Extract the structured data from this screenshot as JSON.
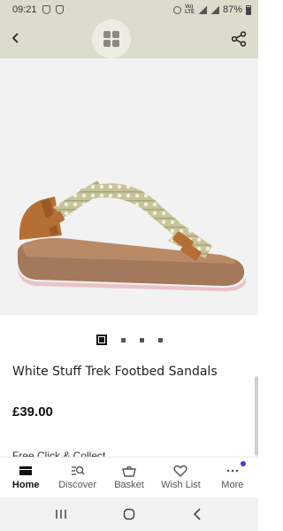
{
  "status_bar": {
    "time": "09:21",
    "battery": "87%"
  },
  "product": {
    "title": "White Stuff Trek Footbed Sandals",
    "price": "£39.00",
    "collect_text": "Free Click & Collect"
  },
  "pager": {
    "count": 4,
    "active_index": 0
  },
  "nav": {
    "items": [
      {
        "label": "Home",
        "icon": "home-icon"
      },
      {
        "label": "Discover",
        "icon": "discover-icon"
      },
      {
        "label": "Basket",
        "icon": "basket-icon"
      },
      {
        "label": "Wish List",
        "icon": "heart-icon"
      },
      {
        "label": "More",
        "icon": "more-icon"
      }
    ]
  },
  "colors": {
    "header_bg": "#dcdccc",
    "badge": "#3b3bdb"
  }
}
